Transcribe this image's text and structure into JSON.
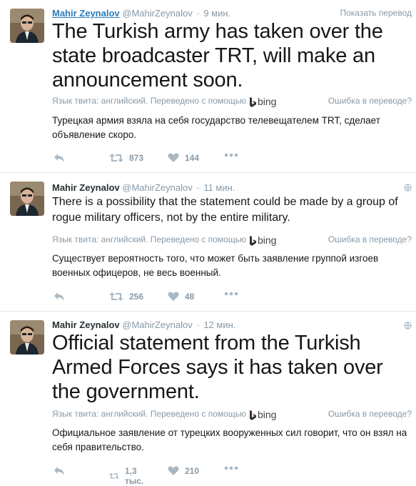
{
  "tweets": [
    {
      "author": "Mahir Zeynalov",
      "handle": "@MahirZeynalov",
      "sep": "·",
      "time": "9 мин.",
      "corner": "Показать перевод",
      "text": "The Turkish army has taken over the state broadcaster TRT, will make an announcement soon.",
      "translation_credit": "Язык твита: английский. Переведено с помощью",
      "bing": "bing",
      "error_link": "Ошибка в переводе?",
      "translation": "Турецкая армия взяла на себя государство телевещателем TRT, сделает объявление скоро.",
      "retweets": "873",
      "likes": "144"
    },
    {
      "author": "Mahir Zeynalov",
      "handle": "@MahirZeynalov",
      "sep": "·",
      "time": "11 мин.",
      "text": "There is a possibility that the statement could be made by a group of rogue military officers, not by the entire military.",
      "translation_credit": "Язык твита: английский. Переведено с помощью",
      "bing": "bing",
      "error_link": "Ошибка в переводе?",
      "translation": "Существует вероятность того, что может быть заявление группой изгоев военных офицеров, не весь военный.",
      "retweets": "256",
      "likes": "48"
    },
    {
      "author": "Mahir Zeynalov",
      "handle": "@MahirZeynalov",
      "sep": "·",
      "time": "12 мин.",
      "text": "Official statement from the Turkish Armed Forces says it has taken over the government.",
      "translation_credit": "Язык твита: английский. Переведено с помощью",
      "bing": "bing",
      "error_link": "Ошибка в переводе?",
      "translation": "Официальное заявление от турецких вооруженных сил говорит, что он взял на себя правительство.",
      "retweets": "1,3 тыс.",
      "likes": "210"
    }
  ],
  "colors": {
    "link": "#2b7bb9",
    "muted": "#8899a6",
    "icon": "#aab8c2"
  }
}
